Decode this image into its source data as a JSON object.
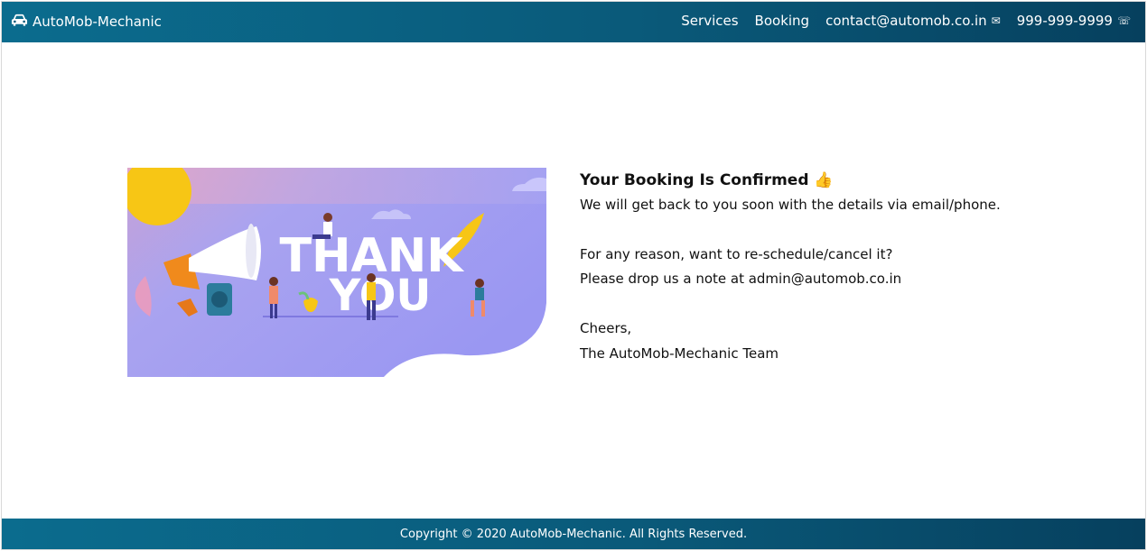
{
  "navbar": {
    "brand": "AutoMob-Mechanic",
    "brand_icon": "car-icon",
    "links": [
      {
        "label": "Services"
      },
      {
        "label": "Booking"
      },
      {
        "label": "contact@automob.co.in",
        "icon": "envelope-icon",
        "glyph": "✉"
      },
      {
        "label": "999-999-9999",
        "icon": "phone-icon",
        "glyph": "☏"
      }
    ]
  },
  "hero": {
    "thank": "THANK",
    "you": "YOU"
  },
  "message": {
    "title": "Your Booking Is Confirmed",
    "title_emoji": "👍",
    "line1": "We will get back to you soon with the details via email/phone.",
    "line2": "For any reason, want to re-schedule/cancel it?",
    "line3": "Please drop us a note at admin@automob.co.in",
    "line4": "Cheers,",
    "line5": "The AutoMob-Mechanic Team"
  },
  "footer": {
    "copyright": "Copyright © 2020 AutoMob-Mechanic. All Rights Reserved."
  },
  "colors": {
    "nav_start": "#0b6c8e",
    "nav_end": "#06405e",
    "hero_bg": "#a39cf2"
  }
}
